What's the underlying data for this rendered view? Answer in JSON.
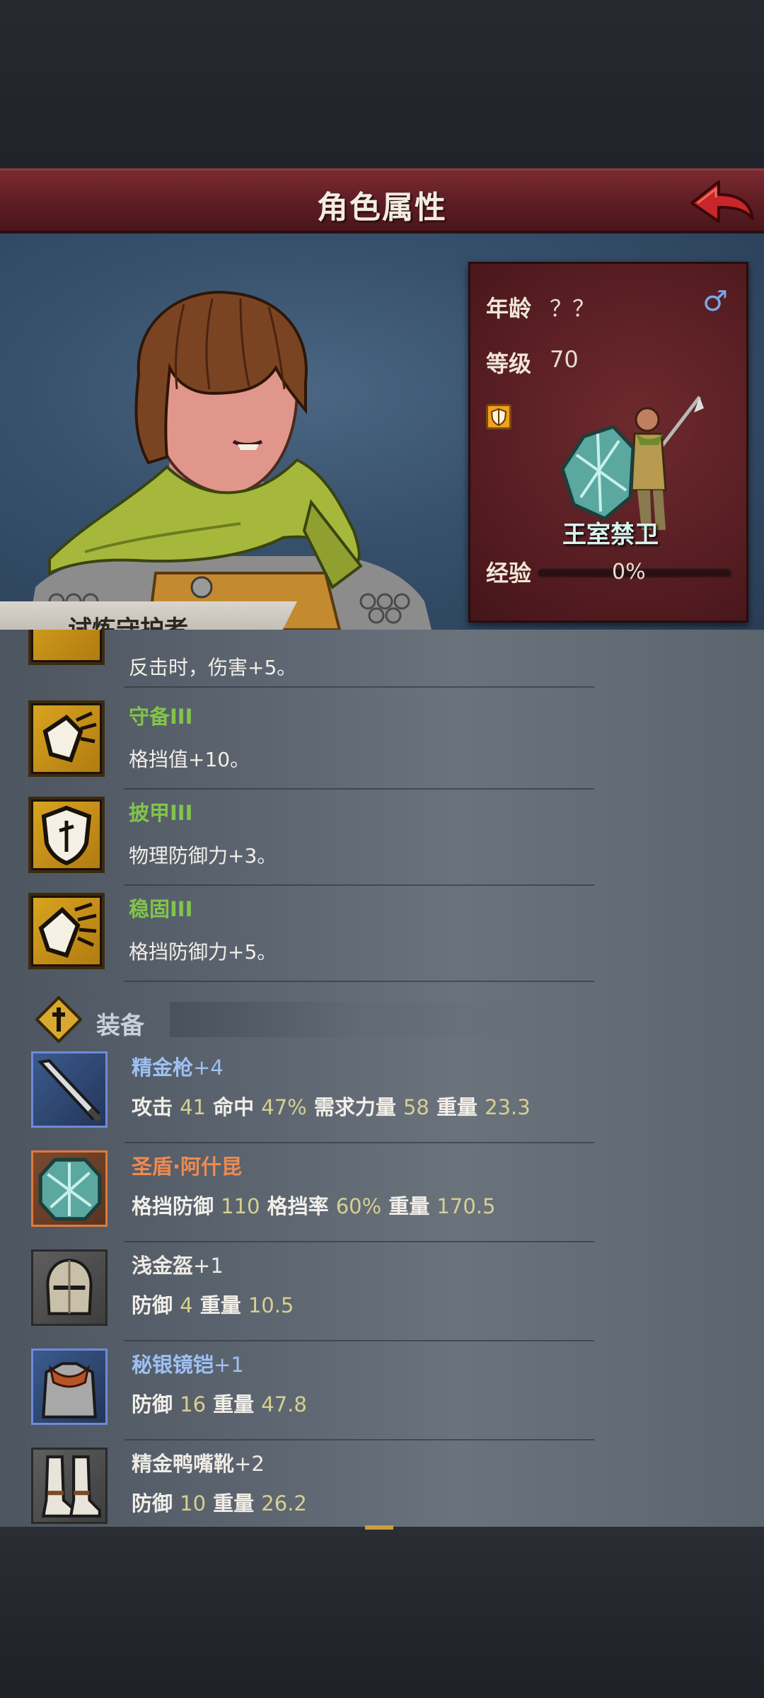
{
  "header": {
    "title": "角色属性"
  },
  "character": {
    "age_label": "年龄",
    "age_value": "？？",
    "level_label": "等级",
    "level_value": "70",
    "gender_symbol": "♂",
    "class_name": "王室禁卫",
    "exp_label": "经验",
    "exp_value": "0%",
    "exp_progress": 0,
    "title": "试炼守护者"
  },
  "skills": [
    {
      "name": "",
      "desc": "反击时，伤害+5。",
      "icon": "counter-attack-icon"
    },
    {
      "name": "守备III",
      "desc": "格挡值+10。",
      "icon": "guard-stance-icon"
    },
    {
      "name": "披甲III",
      "desc": "物理防御力+3。",
      "icon": "armor-shield-icon"
    },
    {
      "name": "稳固III",
      "desc": "格挡防御力+5。",
      "icon": "steady-block-icon"
    }
  ],
  "equipment_section": {
    "title": "装备"
  },
  "equipment": [
    {
      "name": "精金枪",
      "suffix": "+4",
      "name_color": "#9ec0f2",
      "frame_color": "#6f8ad8",
      "icon": "spear-icon",
      "stats": [
        {
          "label": "攻击",
          "value": "41"
        },
        {
          "label": "命中",
          "value": "47%"
        },
        {
          "label": "需求力量",
          "value": "58"
        },
        {
          "label": "重量",
          "value": "23.3"
        }
      ]
    },
    {
      "name": "圣盾·阿什昆",
      "suffix": "",
      "name_color": "#f08a50",
      "frame_color": "#e07a3a",
      "icon": "holy-shield-icon",
      "stats": [
        {
          "label": "格挡防御",
          "value": "110"
        },
        {
          "label": "格挡率",
          "value": "60%"
        },
        {
          "label": "重量",
          "value": "170.5"
        }
      ]
    },
    {
      "name": "浅金盔",
      "suffix": "+1",
      "name_color": "#eeeae4",
      "frame_color": "#2e2e2e",
      "icon": "helmet-icon",
      "stats": [
        {
          "label": "防御",
          "value": "4"
        },
        {
          "label": "重量",
          "value": "10.5"
        }
      ]
    },
    {
      "name": "秘银镜铠",
      "suffix": "+1",
      "name_color": "#9ec0f2",
      "frame_color": "#6f8ad8",
      "icon": "chest-armor-icon",
      "stats": [
        {
          "label": "防御",
          "value": "16"
        },
        {
          "label": "重量",
          "value": "47.8"
        }
      ]
    },
    {
      "name": "精金鸭嘴靴",
      "suffix": "+2",
      "name_color": "#eeeae4",
      "frame_color": "#2e2e2e",
      "icon": "boots-icon",
      "stats": [
        {
          "label": "防御",
          "value": "10"
        },
        {
          "label": "重量",
          "value": "26.2"
        }
      ]
    }
  ],
  "colors": {
    "skill_name": "#82c44a",
    "stat_value": "#d7cf92",
    "title_bar": "#6a2228"
  }
}
